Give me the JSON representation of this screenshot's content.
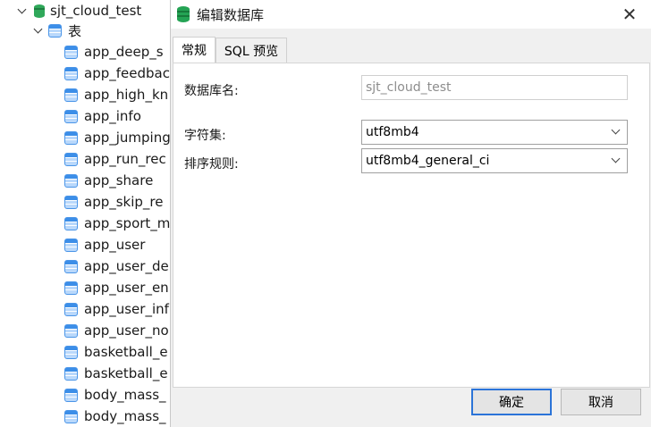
{
  "tree": {
    "database": "sjt_cloud_test",
    "group": "表",
    "tables": [
      "app_deep_s",
      "app_feedbac",
      "app_high_kn",
      "app_info",
      "app_jumping",
      "app_run_rec",
      "app_share",
      "app_skip_re",
      "app_sport_m",
      "app_user",
      "app_user_de",
      "app_user_en",
      "app_user_inf",
      "app_user_no",
      "basketball_e",
      "basketball_e",
      "body_mass_",
      "body_mass_"
    ]
  },
  "dialog": {
    "title": "编辑数据库",
    "tabs": [
      {
        "label": "常规",
        "active": true
      },
      {
        "label": "SQL 预览",
        "active": false
      }
    ],
    "fields": {
      "db_name_label": "数据库名:",
      "db_name_value": "sjt_cloud_test",
      "charset_label": "字符集:",
      "charset_value": "utf8mb4",
      "collation_label": "排序规则:",
      "collation_value": "utf8mb4_general_ci"
    },
    "buttons": {
      "ok": "确定",
      "cancel": "取消"
    }
  }
}
